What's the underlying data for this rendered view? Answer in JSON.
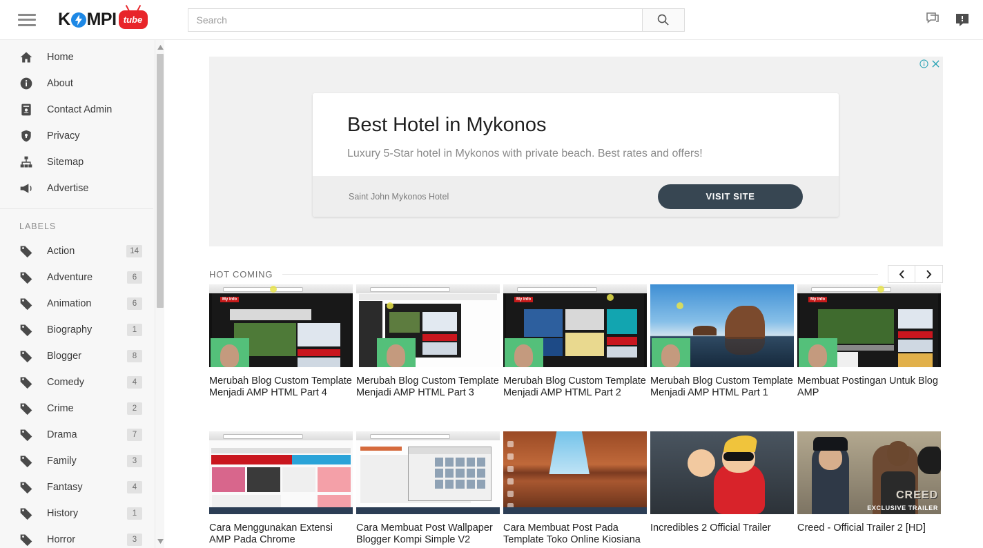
{
  "header": {
    "menu_icon": "hamburger-icon",
    "logo": {
      "text": "KOMPI",
      "badge": "tube"
    },
    "search": {
      "value": "",
      "placeholder": "Search",
      "button_icon": "search-icon"
    },
    "icons": [
      {
        "name": "comments-icon"
      },
      {
        "name": "notification-bubble-icon"
      }
    ]
  },
  "sidebar": {
    "nav": [
      {
        "label": "Home",
        "icon": "home-icon"
      },
      {
        "label": "About",
        "icon": "info-icon"
      },
      {
        "label": "Contact Admin",
        "icon": "contact-card-icon"
      },
      {
        "label": "Privacy",
        "icon": "shield-lock-icon"
      },
      {
        "label": "Sitemap",
        "icon": "sitemap-icon"
      },
      {
        "label": "Advertise",
        "icon": "megaphone-icon"
      }
    ],
    "labels_heading": "LABELS",
    "labels": [
      {
        "name": "Action",
        "count": "14"
      },
      {
        "name": "Adventure",
        "count": "6"
      },
      {
        "name": "Animation",
        "count": "6"
      },
      {
        "name": "Biography",
        "count": "1"
      },
      {
        "name": "Blogger",
        "count": "8"
      },
      {
        "name": "Comedy",
        "count": "4"
      },
      {
        "name": "Crime",
        "count": "2"
      },
      {
        "name": "Drama",
        "count": "7"
      },
      {
        "name": "Family",
        "count": "3"
      },
      {
        "name": "Fantasy",
        "count": "4"
      },
      {
        "name": "History",
        "count": "1"
      },
      {
        "name": "Horror",
        "count": "3"
      }
    ]
  },
  "ad": {
    "title": "Best Hotel in Mykonos",
    "description": "Luxury 5-Star hotel in Mykonos with private beach. Best rates and offers!",
    "brand": "Saint John Mykonos Hotel",
    "cta": "VISIT SITE",
    "info_icon": "adchoices-info-icon",
    "close_icon": "close-icon"
  },
  "section": {
    "title": "HOT COMING",
    "prev_icon": "chevron-left-icon",
    "next_icon": "chevron-right-icon"
  },
  "videos": {
    "row1": [
      {
        "title": "Merubah Blog Custom Template Menjadi AMP HTML Part 4"
      },
      {
        "title": "Merubah Blog Custom Template Menjadi AMP HTML Part 3"
      },
      {
        "title": "Merubah Blog Custom Template Menjadi AMP HTML Part 2"
      },
      {
        "title": "Merubah Blog Custom Template Menjadi AMP HTML Part 1"
      },
      {
        "title": "Membuat Postingan Untuk Blog AMP"
      }
    ],
    "row2": [
      {
        "title": "Cara Menggunakan Extensi AMP Pada Chrome"
      },
      {
        "title": "Cara Membuat Post Wallpaper Blogger Kompi Simple V2"
      },
      {
        "title": "Cara Membuat Post Pada Template Toko Online Kiosiana"
      },
      {
        "title": "Incredibles 2 Official Trailer"
      },
      {
        "title": "Creed - Official Trailer 2 [HD]"
      }
    ]
  },
  "thumbnail_overlays": {
    "creed_title": "CREED",
    "creed_sub": "EXCLUSIVE TRAILER",
    "blog_logo": "My Info"
  },
  "colors": {
    "logo_blue": "#1e88e5",
    "logo_red": "#e8252a",
    "ad_cta": "#374652",
    "sidebar_bg": "#f7f7f7",
    "adchoices_teal": "#2aa3b5"
  }
}
